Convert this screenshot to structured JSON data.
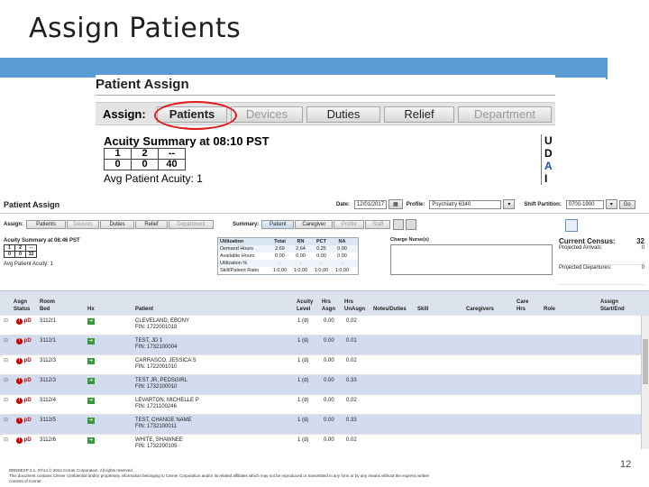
{
  "slide": {
    "title": "Assign Patients",
    "page_number": "12",
    "footer_line1": "BRNDEXP 2.1, 07/14     © 2014 Cerner Corporation. All rights reserved.",
    "footer_line2": "This document contains Cerner confidential and/or proprietary information belonging to Cerner Corporation and/or its related affiliates which may not be reproduced or transmitted in any form or by any means without the express written",
    "footer_line3": "consent of Cerner."
  },
  "zoom": {
    "title": "Patient Assign",
    "assign_label": "Assign:",
    "tabs": [
      {
        "label": "Patients"
      },
      {
        "label": "Devices"
      },
      {
        "label": "Duties"
      },
      {
        "label": "Relief"
      },
      {
        "label": "Department"
      }
    ],
    "acuity_title": "Acuity Summary at 08:10 PST",
    "acuity_rows": [
      [
        "1",
        "2",
        "--"
      ],
      [
        "0",
        "0",
        "40"
      ]
    ],
    "avg_acuity": "Avg Patient Acuity: 1",
    "right_fragment": [
      "U",
      "D",
      "A",
      "I"
    ]
  },
  "app": {
    "title": "Patient Assign",
    "date_label": "Date:",
    "date_value": "12/01/2017",
    "profile_label": "Profile:",
    "profile_value": "Psychiatry 6340",
    "shift_label": "Shift Partition:",
    "shift_value": "0700-1900",
    "go_label": "Go",
    "assign_label": "Assign:",
    "tabs": [
      "Patients",
      "Devices",
      "Duties",
      "Relief",
      "Department"
    ],
    "summary_label": "Summary:",
    "summary_tabs": [
      "Patient",
      "Caregiver",
      "Profile",
      "Staff"
    ],
    "acuity_title": "Acuity Summary at 08:46 PST",
    "acuity_rows": [
      [
        "1",
        "2",
        "--"
      ],
      [
        "0",
        "0",
        "32"
      ]
    ],
    "avg_acuity": "Avg Patient Acuity: 1",
    "util_headers": [
      "Utilization",
      "Total",
      "RN",
      "PCT",
      "NA"
    ],
    "util_rows": [
      [
        "Demand Hours",
        "2.69",
        "2.64",
        "0.25",
        "0.00"
      ],
      [
        "Available Hours",
        "0.00",
        "0.00",
        "0.00",
        "0.00"
      ],
      [
        "Utilization %",
        ".",
        ".",
        ".",
        "."
      ],
      [
        "Skill/Patient Ratio",
        "1:0.00",
        "1:0.00",
        "1:0.00",
        "1:0.00"
      ]
    ],
    "charge_label": "Charge Nurse(s)",
    "census_label": "Current Census:",
    "census_value": "32",
    "proj_arrivals_label": "Projected Arrivals:",
    "proj_arrivals_value": "0",
    "proj_departures_label": "Projected Departures:",
    "proj_departures_value": "0",
    "grid_headers": {
      "asgn": "Asgn",
      "status": "Status",
      "room": "Room",
      "bed": "Bed",
      "hx": "Hx",
      "patient": "Patient",
      "acuity": "Acuity",
      "level": "Level",
      "hrs1": "Hrs",
      "asgn2": "Asgn",
      "hrs2": "Hrs",
      "unasgn": "UnAsgn",
      "notes": "Notes/Duties",
      "skill": "Skill",
      "caregivers": "Caregivers",
      "care": "Care",
      "hrs3": "Hrs",
      "role": "Role",
      "assign": "Assign",
      "startend": "Start/End"
    },
    "rows": [
      {
        "status": "pD",
        "room": "3112/1",
        "name": "CLEVELAND, EBONY",
        "fin": "FIN: 1722001018",
        "level": "1 (d)",
        "asgn": "0.00",
        "unasgn": "0.02"
      },
      {
        "status": "pD",
        "room": "3112/1",
        "name": "TEST, JD 1",
        "fin": "FIN: 1732100004",
        "level": "1 (d)",
        "asgn": "0.00",
        "unasgn": "0.01"
      },
      {
        "status": "pD",
        "room": "3112/3",
        "name": "CARRASCO, JESSICA S",
        "fin": "FIN: 1722001010",
        "level": "1 (d)",
        "asgn": "0.00",
        "unasgn": "0.02"
      },
      {
        "status": "pD",
        "room": "3112/3",
        "name": "TEST JR, PEDSGIRL",
        "fin": "FIN: 1732100010",
        "level": "1 (d)",
        "asgn": "0.00",
        "unasgn": "0.33"
      },
      {
        "status": "pD",
        "room": "3112/4",
        "name": "LEVARTON, MICHELLE P",
        "fin": "FIN: 1721100246",
        "level": "1 (d)",
        "asgn": "0.00",
        "unasgn": "0.02"
      },
      {
        "status": "pD",
        "room": "3112/5",
        "name": "TEST, CHANGE NAME",
        "fin": "FIN: 1732100011",
        "level": "1 (d)",
        "asgn": "0.00",
        "unasgn": "0.33"
      },
      {
        "status": "pD",
        "room": "3112/6",
        "name": "WHITE, SHAWNEE",
        "fin": "FIN: 1732200105",
        "level": "1 (d)",
        "asgn": "0.00",
        "unasgn": "0.02"
      }
    ]
  }
}
